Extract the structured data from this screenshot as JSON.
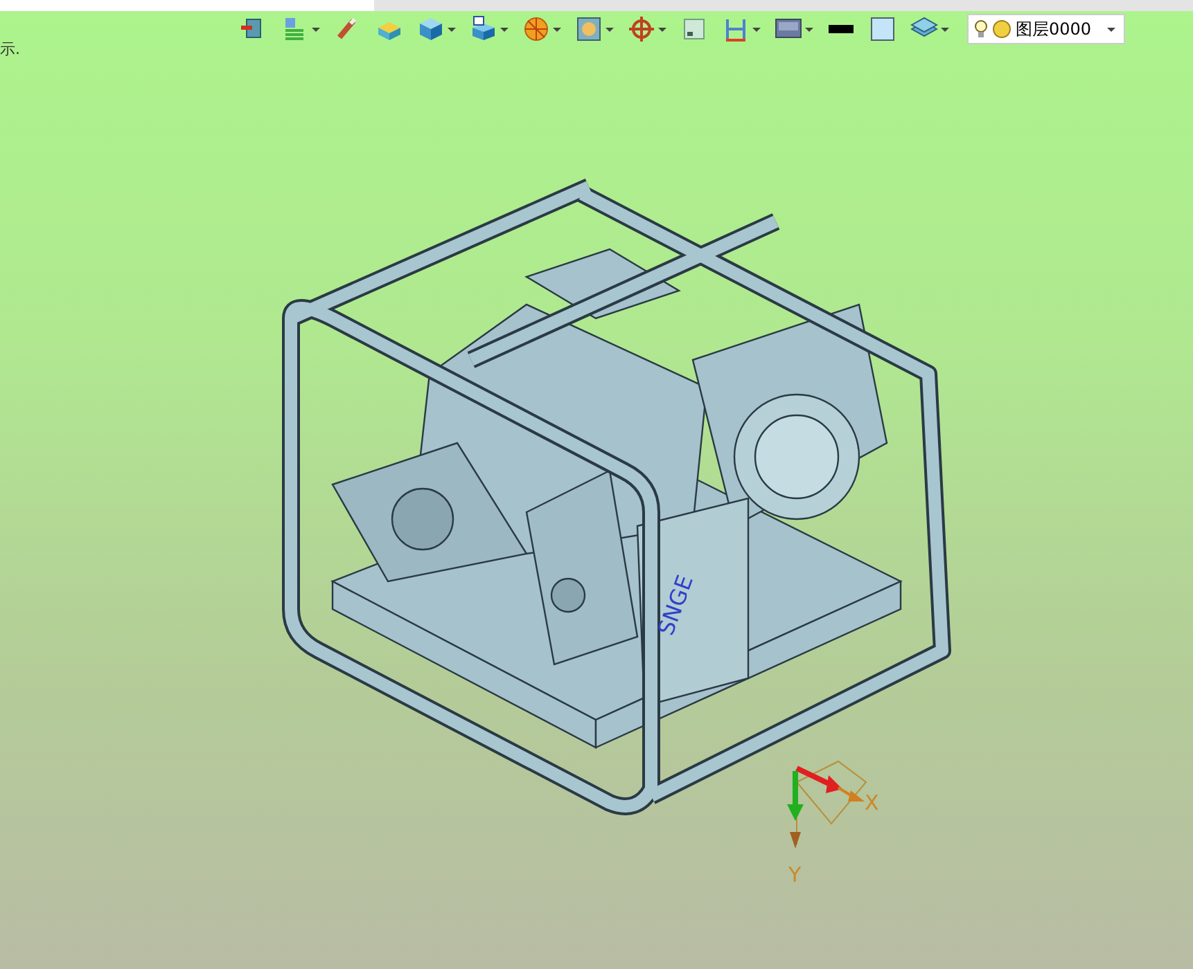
{
  "side_note": "示.",
  "toolbar": [
    {
      "dropdown": false
    },
    {
      "dropdown": true
    },
    {
      "dropdown": false
    },
    {
      "dropdown": false
    },
    {
      "dropdown": true
    },
    {
      "dropdown": true
    },
    {
      "dropdown": true
    },
    {
      "dropdown": true
    },
    {
      "dropdown": true
    },
    {
      "dropdown": false
    },
    {
      "dropdown": true
    },
    {
      "dropdown": true
    },
    {
      "dropdown": false
    },
    {
      "dropdown": false
    },
    {
      "dropdown": true
    }
  ],
  "layer_combo": {
    "value": "图层0000"
  },
  "axes": {
    "x_label": "X",
    "y_label": "Y"
  },
  "model_label": "SNGE"
}
